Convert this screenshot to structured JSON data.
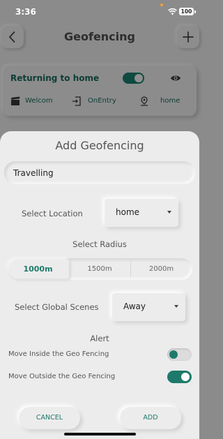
{
  "status_bar": {
    "time": "3:36",
    "battery": "100",
    "indicator_color": "#f5a033"
  },
  "background_page": {
    "title": "Geofencing",
    "back_icon": "chevron-left-icon",
    "add_icon": "plus-icon",
    "card": {
      "name": "Returning to home",
      "enabled": true,
      "scene": "Welcom",
      "trigger": "OnEntry",
      "location": "home"
    }
  },
  "dialog": {
    "title": "Add Geofencing",
    "name_value": "Travelling",
    "location_label": "Select Location",
    "location_value": "home",
    "radius_label": "Select Radius",
    "radius_options": [
      "1000m",
      "1500m",
      "2000m"
    ],
    "radius_selected": "1000m",
    "scene_label": "Select Global Scenes",
    "scene_value": "Away",
    "alert_label": "Alert",
    "alerts": [
      {
        "label": "Move Inside the Geo Fencing",
        "on": false
      },
      {
        "label": "Move Outside the Geo Fencing",
        "on": true
      }
    ],
    "cancel_label": "CANCEL",
    "add_label": "ADD"
  },
  "colors": {
    "accent": "#1d7a6a",
    "sheet_bg": "#ececec",
    "overlay_bg": "#8b8b8b"
  }
}
